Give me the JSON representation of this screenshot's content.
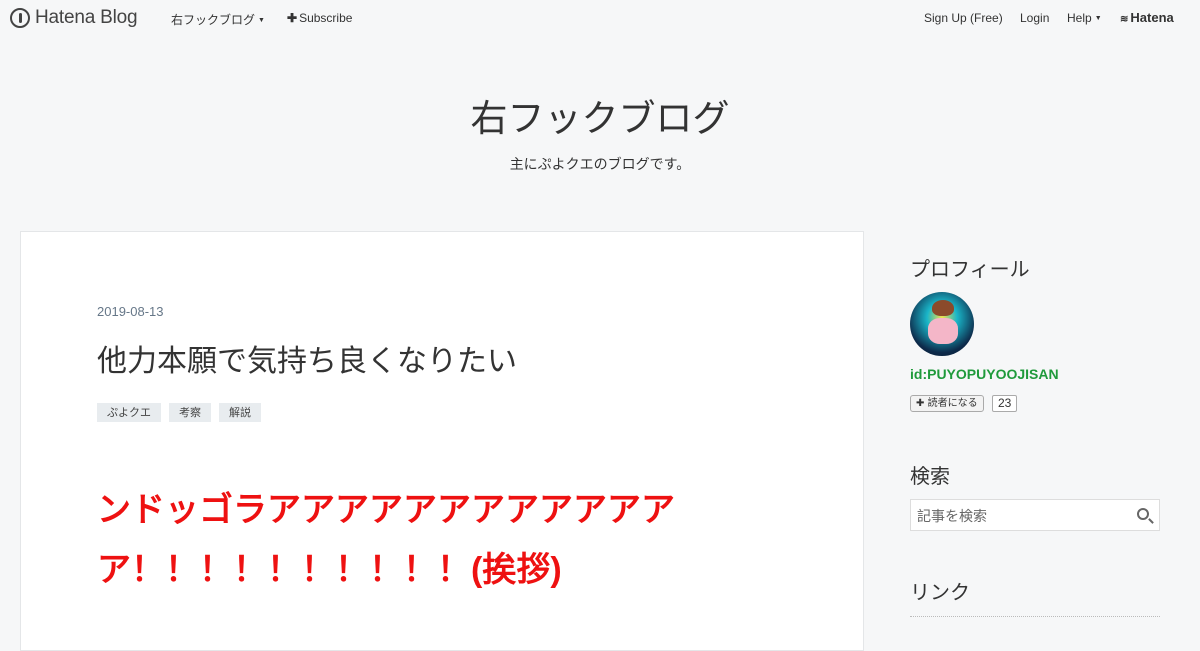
{
  "global_header": {
    "logo_text": "Hatena Blog",
    "blog_menu_label": "右フックブログ",
    "subscribe_label": "Subscribe",
    "signup_label": "Sign Up (Free)",
    "login_label": "Login",
    "help_label": "Help",
    "hatena_label": "Hatena"
  },
  "blog": {
    "title": "右フックブログ",
    "description": "主にぷよクエのブログです。"
  },
  "entry": {
    "date": "2019-08-13",
    "title": "他力本願で気持ち良くなりたい",
    "categories": [
      "ぷよクエ",
      "考察",
      "解説"
    ],
    "body_line1": "ンドッゴラアアアアアアアアアアアア",
    "body_line2": "ア！！！！！！！！！！(挨拶)"
  },
  "sidebar": {
    "profile_heading": "プロフィール",
    "profile_id": "id:PUYOPUYOOJISAN",
    "reader_button_label": "読者になる",
    "reader_count": "23",
    "search_heading": "検索",
    "search_placeholder": "記事を検索",
    "links_heading": "リンク"
  },
  "colors": {
    "background": "#f6f7f8",
    "body_text_accent": "#ee1111",
    "profile_id": "#1f9a3b"
  }
}
